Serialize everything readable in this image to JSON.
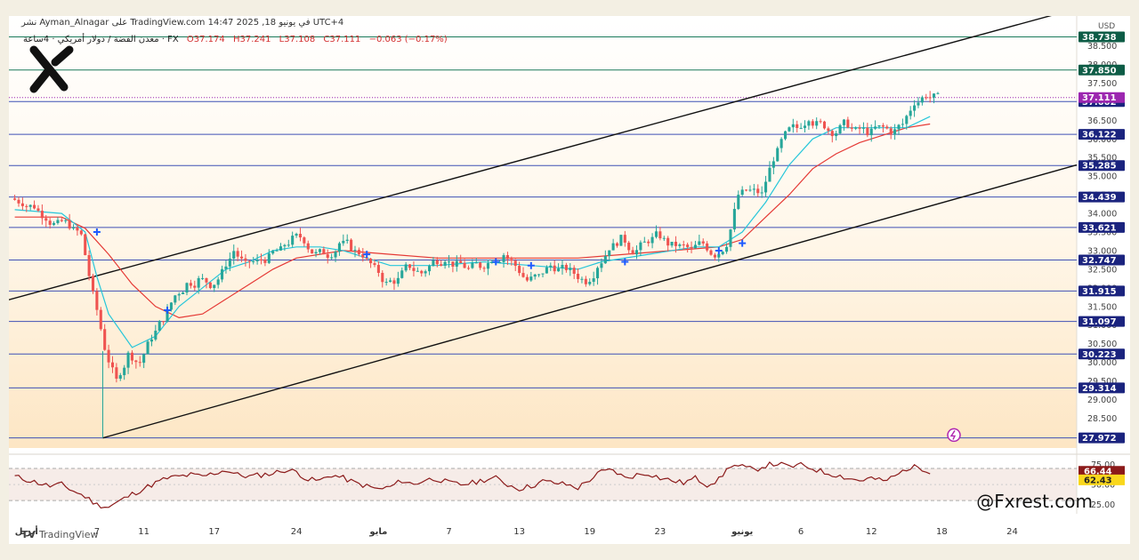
{
  "header": {
    "publisher_line": "نشر Ayman_Alnagar على TradingView.com في يونيو 18, 2025 14:47 UTC+4",
    "symbol": "معدن الفضة / دولار أمريكي · 4ساعة · FX",
    "open": "O37.174",
    "high": "H37.241",
    "low": "L37.108",
    "close": "C37.111",
    "change": "−0.063 (−0.17%)"
  },
  "branding": {
    "watermark": "@Fxrest.com",
    "footer": "TradingView",
    "footer_icon": "tradingview-logo-icon",
    "logo_icon": "x-logo-icon",
    "alert_icon": "lightning-icon"
  },
  "colors": {
    "bull": "#26a69a",
    "bear": "#ef5350",
    "level_line": "#3f51b5",
    "level_label_bg": "#1a237e",
    "ma_fast": "#26c6da",
    "ma_slow": "#e53935",
    "channel": "#111111",
    "rsi_line": "#8b1a1a",
    "last_price_bg": "#9c27b0",
    "rsi_last_bg": "#8b1a1a",
    "rsi_ma_bg": "#f9d71c",
    "signal_marker": "#1e5bff"
  },
  "chart_data": {
    "type": "candlestick",
    "currency": "USD",
    "price_axis": {
      "range": [
        27.7,
        39.3
      ],
      "ticks": [
        "38.500",
        "38.000",
        "37.500",
        "36.500",
        "36.000",
        "35.500",
        "35.000",
        "34.500",
        "34.000",
        "33.500",
        "33.000",
        "32.500",
        "32.000",
        "31.500",
        "31.000",
        "30.500",
        "30.000",
        "29.500",
        "29.000",
        "28.500"
      ]
    },
    "time_axis": {
      "ticks": [
        {
          "label": "أبريل",
          "x": 1.0
        },
        {
          "label": "7",
          "x": 7.0
        },
        {
          "label": "11",
          "x": 11.0
        },
        {
          "label": "17",
          "x": 17.0
        },
        {
          "label": "24",
          "x": 24.0
        },
        {
          "label": "مايو",
          "x": 31.0
        },
        {
          "label": "7",
          "x": 37.0
        },
        {
          "label": "13",
          "x": 43.0
        },
        {
          "label": "19",
          "x": 49.0
        },
        {
          "label": "23",
          "x": 55.0
        },
        {
          "label": "يونيو",
          "x": 62.0
        },
        {
          "label": "6",
          "x": 67.0
        },
        {
          "label": "12",
          "x": 73.0
        },
        {
          "label": "18",
          "x": 79.0
        },
        {
          "label": "24",
          "x": 85.0
        }
      ],
      "range": [
        -0.5,
        90.5
      ]
    },
    "levels": [
      {
        "price": 38.738,
        "label": "38.738",
        "style": "green"
      },
      {
        "price": 37.85,
        "label": "37.850",
        "style": "green"
      },
      {
        "price": 37.002,
        "label": "37.002",
        "style": "blue"
      },
      {
        "price": 36.122,
        "label": "36.122",
        "style": "blue"
      },
      {
        "price": 35.285,
        "label": "35.285",
        "style": "blue"
      },
      {
        "price": 34.439,
        "label": "34.439",
        "style": "blue"
      },
      {
        "price": 33.621,
        "label": "33.621",
        "style": "blue"
      },
      {
        "price": 32.747,
        "label": "32.747",
        "style": "blue"
      },
      {
        "price": 31.915,
        "label": "31.915",
        "style": "blue"
      },
      {
        "price": 31.097,
        "label": "31.097",
        "style": "blue"
      },
      {
        "price": 30.223,
        "label": "30.223",
        "style": "blue"
      },
      {
        "price": 29.314,
        "label": "29.314",
        "style": "blue"
      },
      {
        "price": 27.972,
        "label": "27.972",
        "style": "blue"
      }
    ],
    "last_price": {
      "price": 37.111,
      "label": "37.111"
    },
    "channel": {
      "upper": [
        [
          -0.5,
          31.68
        ],
        [
          90.5,
          39.5
        ]
      ],
      "lower": [
        [
          7.5,
          27.97
        ],
        [
          90.5,
          35.3
        ]
      ]
    },
    "closes": [
      34.3,
      34.2,
      33.9,
      33.7,
      33.7,
      33.4,
      31.8,
      30.4,
      29.5,
      30.2,
      30.0,
      30.7,
      31.2,
      31.8,
      32.1,
      32.2,
      32.1,
      32.4,
      33.0,
      32.6,
      32.7,
      32.8,
      33.0,
      33.3,
      33.3,
      32.9,
      32.9,
      33.2,
      33.1,
      32.9,
      32.5,
      32.1,
      32.2,
      32.6,
      32.4,
      32.7,
      32.8,
      32.6,
      32.5,
      32.6,
      32.8,
      32.9,
      32.6,
      32.2,
      32.3,
      32.6,
      32.5,
      32.4,
      32.2,
      32.6,
      33.1,
      33.3,
      33.0,
      33.2,
      33.4,
      33.2,
      33.1,
      33.0,
      33.2,
      32.9,
      33.2,
      34.5,
      34.6,
      34.5,
      35.5,
      36.1,
      36.3,
      36.6,
      36.4,
      36.2,
      36.4,
      36.2,
      36.2,
      36.3,
      36.2,
      36.4,
      37.0,
      37.2,
      37.111
    ],
    "ma_fast_points": [
      [
        0,
        34.1
      ],
      [
        4,
        34.0
      ],
      [
        6,
        33.5
      ],
      [
        7,
        32.3
      ],
      [
        8,
        31.3
      ],
      [
        10,
        30.4
      ],
      [
        12,
        30.7
      ],
      [
        14,
        31.5
      ],
      [
        16,
        32.0
      ],
      [
        18,
        32.5
      ],
      [
        20,
        32.7
      ],
      [
        22,
        33.0
      ],
      [
        24,
        33.1
      ],
      [
        26,
        33.1
      ],
      [
        28,
        33.0
      ],
      [
        30,
        32.8
      ],
      [
        32,
        32.6
      ],
      [
        36,
        32.6
      ],
      [
        40,
        32.7
      ],
      [
        44,
        32.6
      ],
      [
        48,
        32.5
      ],
      [
        50,
        32.7
      ],
      [
        54,
        32.9
      ],
      [
        58,
        33.1
      ],
      [
        60,
        33.1
      ],
      [
        62,
        33.5
      ],
      [
        64,
        34.3
      ],
      [
        66,
        35.3
      ],
      [
        68,
        36.0
      ],
      [
        70,
        36.3
      ],
      [
        74,
        36.3
      ],
      [
        76,
        36.3
      ],
      [
        78,
        36.6
      ]
    ],
    "ma_slow_points": [
      [
        0,
        33.9
      ],
      [
        4,
        33.9
      ],
      [
        6,
        33.6
      ],
      [
        8,
        32.9
      ],
      [
        10,
        32.1
      ],
      [
        12,
        31.5
      ],
      [
        14,
        31.2
      ],
      [
        16,
        31.3
      ],
      [
        18,
        31.7
      ],
      [
        20,
        32.1
      ],
      [
        22,
        32.5
      ],
      [
        24,
        32.8
      ],
      [
        28,
        33.0
      ],
      [
        32,
        32.9
      ],
      [
        36,
        32.8
      ],
      [
        40,
        32.8
      ],
      [
        44,
        32.8
      ],
      [
        48,
        32.8
      ],
      [
        52,
        32.9
      ],
      [
        56,
        33.0
      ],
      [
        60,
        33.1
      ],
      [
        62,
        33.3
      ],
      [
        64,
        33.9
      ],
      [
        66,
        34.5
      ],
      [
        68,
        35.2
      ],
      [
        70,
        35.6
      ],
      [
        72,
        35.9
      ],
      [
        74,
        36.1
      ],
      [
        76,
        36.3
      ],
      [
        78,
        36.4
      ]
    ],
    "signal_markers": [
      [
        7,
        33.5
      ],
      [
        13,
        31.4
      ],
      [
        30,
        32.9
      ],
      [
        41,
        32.7
      ],
      [
        44,
        32.6
      ],
      [
        52,
        32.7
      ],
      [
        60,
        33.0
      ],
      [
        62,
        33.2
      ]
    ],
    "rsi": {
      "axis_ticks": [
        "75.00",
        "50.00",
        "25.00"
      ],
      "range": [
        18,
        80
      ],
      "levels_dashed": [
        70,
        30
      ],
      "last": {
        "value": 66.44,
        "label": "66.44"
      },
      "ma": {
        "value": 62.43,
        "label": "62.43"
      },
      "values": [
        60,
        56,
        52,
        48,
        50,
        42,
        35,
        25,
        22,
        30,
        38,
        45,
        52,
        58,
        60,
        62,
        60,
        64,
        68,
        62,
        60,
        62,
        64,
        68,
        66,
        56,
        55,
        62,
        58,
        52,
        48,
        44,
        47,
        55,
        50,
        56,
        57,
        52,
        50,
        52,
        56,
        58,
        50,
        45,
        48,
        54,
        52,
        50,
        46,
        56,
        66,
        68,
        58,
        62,
        64,
        58,
        55,
        52,
        58,
        50,
        56,
        74,
        72,
        68,
        74,
        76,
        72,
        74,
        70,
        65,
        62,
        58,
        55,
        58,
        54,
        60,
        70,
        72,
        66.44
      ]
    }
  }
}
